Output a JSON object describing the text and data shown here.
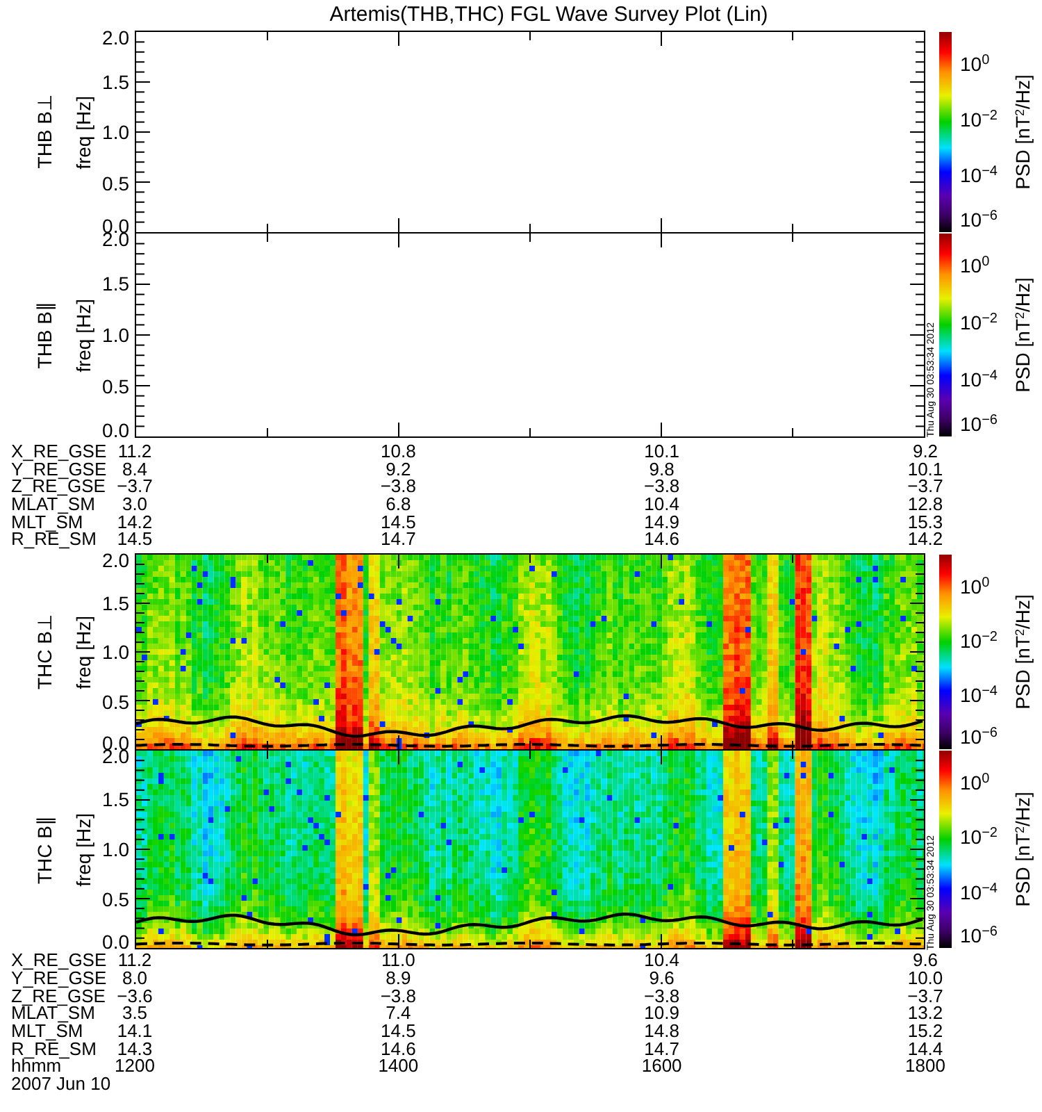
{
  "title": "Artemis(THB,THC) FGL Wave Survey Plot (Lin)",
  "groups": [
    {
      "panels": [
        {
          "label": "THB B⊥",
          "axis_label": "freq [Hz]",
          "yticks": [
            "2.0",
            "1.5",
            "1.0",
            "0.5",
            "0.0"
          ],
          "has_data": false,
          "colorbar": {
            "ticks": [
              "10$^{0}$",
              "10$^{−2}$",
              "10$^{−4}$",
              "10$^{−6}$"
            ],
            "label": "PSD [nT$^{2}$/Hz]"
          }
        },
        {
          "label": "THB B∥",
          "axis_label": "freq [Hz]",
          "yticks": [
            "2.0",
            "1.5",
            "1.0",
            "0.5",
            "0.0"
          ],
          "has_data": false,
          "timestamp": "Thu Aug 30 03:53:34 2012",
          "colorbar": {
            "ticks": [
              "10$^{0}$",
              "10$^{−2}$",
              "10$^{−4}$",
              "10$^{−6}$"
            ],
            "label": "PSD [nT$^{2}$/Hz]"
          }
        }
      ],
      "ephemeris": [
        {
          "name": "X_RE_GSE",
          "values": [
            "11.2",
            "10.8",
            "10.1",
            "9.2"
          ]
        },
        {
          "name": "Y_RE_GSE",
          "values": [
            "8.4",
            "9.2",
            "9.8",
            "10.1"
          ]
        },
        {
          "name": "Z_RE_GSE",
          "values": [
            "−3.7",
            "−3.8",
            "−3.8",
            "−3.7"
          ]
        },
        {
          "name": "MLAT_SM",
          "values": [
            "3.0",
            "6.8",
            "10.4",
            "12.8"
          ]
        },
        {
          "name": "MLT_SM",
          "values": [
            "14.2",
            "14.5",
            "14.9",
            "15.3"
          ]
        },
        {
          "name": "R_RE_SM",
          "values": [
            "14.5",
            "14.7",
            "14.6",
            "14.2"
          ]
        }
      ]
    },
    {
      "panels": [
        {
          "label": "THC B⊥",
          "axis_label": "freq [Hz]",
          "yticks": [
            "2.0",
            "1.5",
            "1.0",
            "0.5",
            "0.0"
          ],
          "has_data": true,
          "colorbar": {
            "ticks": [
              "10$^{0}$",
              "10$^{−2}$",
              "10$^{−4}$",
              "10$^{−6}$"
            ],
            "label": "PSD [nT$^{2}$/Hz]"
          }
        },
        {
          "label": "THC B∥",
          "axis_label": "freq [Hz]",
          "yticks": [
            "2.0",
            "1.5",
            "1.0",
            "0.5",
            "0.0"
          ],
          "has_data": true,
          "timestamp": "Thu Aug 30 03:53:34 2012",
          "colorbar": {
            "ticks": [
              "10$^{0}$",
              "10$^{−2}$",
              "10$^{−4}$",
              "10$^{−6}$"
            ],
            "label": "PSD [nT$^{2}$/Hz]"
          }
        }
      ],
      "ephemeris": [
        {
          "name": "X_RE_GSE",
          "values": [
            "11.2",
            "11.0",
            "10.4",
            "9.6"
          ]
        },
        {
          "name": "Y_RE_GSE",
          "values": [
            "8.0",
            "8.9",
            "9.6",
            "10.0"
          ]
        },
        {
          "name": "Z_RE_GSE",
          "values": [
            "−3.6",
            "−3.8",
            "−3.8",
            "−3.7"
          ]
        },
        {
          "name": "MLAT_SM",
          "values": [
            "3.5",
            "7.4",
            "10.9",
            "13.2"
          ]
        },
        {
          "name": "MLT_SM",
          "values": [
            "14.1",
            "14.5",
            "14.8",
            "15.2"
          ]
        },
        {
          "name": "R_RE_SM",
          "values": [
            "14.3",
            "14.6",
            "14.7",
            "14.4"
          ]
        },
        {
          "name": "hhmm",
          "values": [
            "1200",
            "1400",
            "1600",
            "1800"
          ]
        }
      ]
    }
  ],
  "date": "2007 Jun 10"
}
